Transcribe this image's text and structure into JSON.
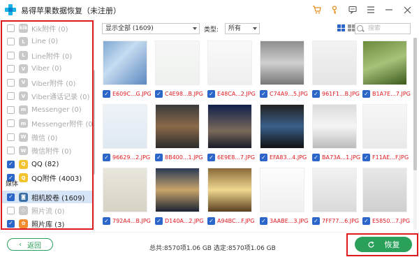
{
  "window": {
    "title": "易得苹果数据恢复（未注册）",
    "icons": [
      "cart-icon",
      "key-icon",
      "feedback-icon",
      "menu-icon",
      "minimize-icon",
      "close-icon"
    ]
  },
  "left_panel": {
    "items": [
      {
        "label": "Kik附件 (0)",
        "icon": "kik",
        "checked": false,
        "dim": true
      },
      {
        "label": "Line (0)",
        "icon": "line",
        "checked": false,
        "dim": true
      },
      {
        "label": "Line附件 (0)",
        "icon": "line",
        "checked": false,
        "dim": true
      },
      {
        "label": "Viber (0)",
        "icon": "viber",
        "checked": false,
        "dim": true
      },
      {
        "label": "Viber附件 (0)",
        "icon": "viber",
        "checked": false,
        "dim": true
      },
      {
        "label": "Viber通话记录 (0)",
        "icon": "viber",
        "checked": false,
        "dim": true
      },
      {
        "label": "Messenger (0)",
        "icon": "messenger",
        "checked": false,
        "dim": true
      },
      {
        "label": "Messenger附件 (0)",
        "icon": "messenger",
        "checked": false,
        "dim": true
      },
      {
        "label": "微信 (0)",
        "icon": "wechat",
        "checked": false,
        "dim": true
      },
      {
        "label": "微信附件 (0)",
        "icon": "wechat",
        "checked": false,
        "dim": true
      },
      {
        "label": "QQ (82)",
        "icon": "qq",
        "checked": true,
        "dim": false
      },
      {
        "label": "QQ附件 (4003)",
        "icon": "qq",
        "checked": true,
        "dim": false
      }
    ],
    "section_title": "媒体",
    "media_items": [
      {
        "label": "相机胶卷 (1609)",
        "icon": "camera",
        "checked": true,
        "dim": false,
        "selected": true
      },
      {
        "label": "照片流 (0)",
        "icon": "photostream",
        "checked": false,
        "dim": true
      },
      {
        "label": "照片库 (3)",
        "icon": "photolib",
        "checked": true,
        "dim": false
      }
    ]
  },
  "toolbar": {
    "filter_value": "显示全部 (1609)",
    "type_label": "类型:",
    "type_value": "所有",
    "search_placeholder": "搜索"
  },
  "grid": {
    "files": [
      "E609C...G.JPG",
      "C4E98...B.JPG",
      "E48CA...2.JPG",
      "C74A9...5.JPG",
      "961F1...B.JPG",
      "B1A7E...7.JPG",
      "96629...2.JPG",
      "8B400...1.JPG",
      "6E9E8...7.JPG",
      "EFA83...4.JPG",
      "BA73A...1.JPG",
      "F11AE...F.JPG",
      "792A4...B.JPG",
      "D140A...2.JPG",
      "A94BC...F.JPG",
      "3AABE...3.JPG",
      "7FF77...6.JPG",
      "E5850...7.JPG"
    ]
  },
  "bottom": {
    "back_label": "返回",
    "status": "总共:8570项1.06 GB 选定:8570项1.06 GB",
    "recover_label": "恢复"
  },
  "colors": {
    "accent_blue": "#2b66c8",
    "accent_green": "#2aa05a",
    "highlight_red": "#e0191f",
    "selected_row": "#d5e4f7"
  }
}
